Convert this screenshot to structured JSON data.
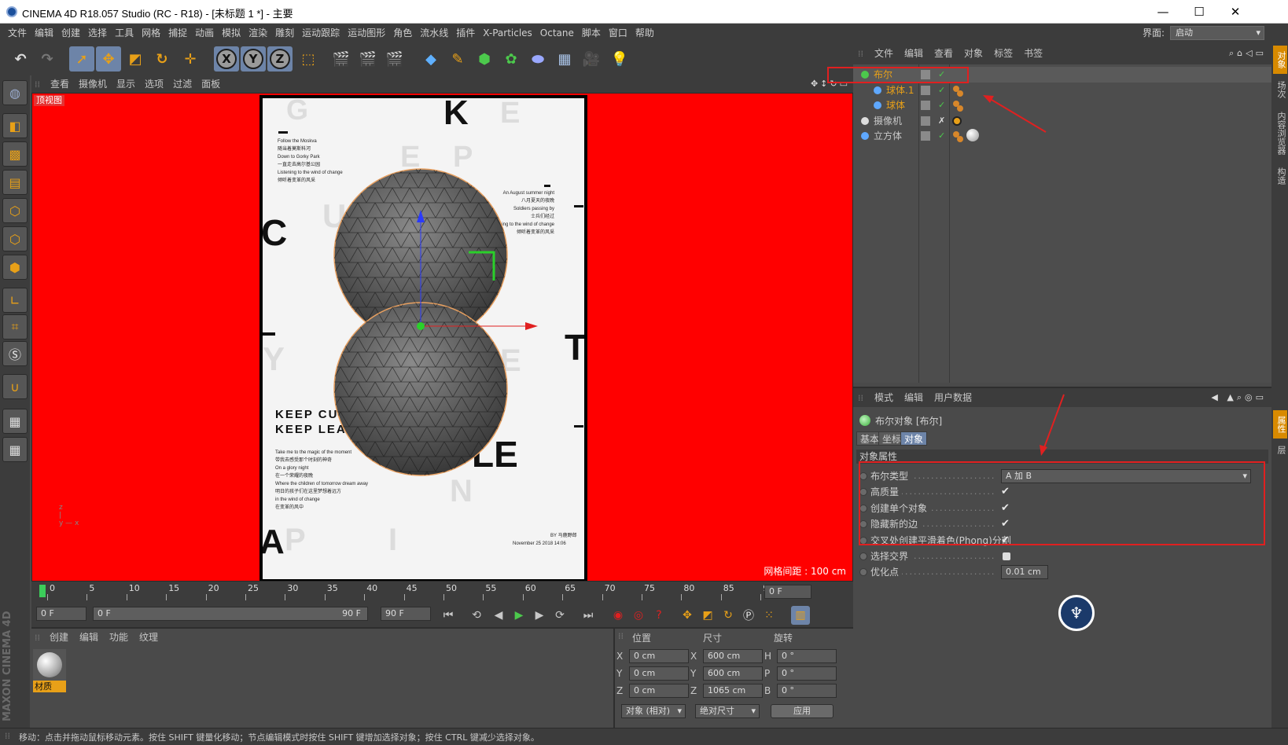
{
  "window": {
    "title": "CINEMA 4D R18.057 Studio (RC - R18) - [未标题 1 *] - 主要",
    "minimize": "—",
    "maximize": "☐",
    "close": "✕"
  },
  "menu": {
    "items": [
      "文件",
      "编辑",
      "创建",
      "选择",
      "工具",
      "网格",
      "捕捉",
      "动画",
      "模拟",
      "渲染",
      "雕刻",
      "运动跟踪",
      "运动图形",
      "角色",
      "流水线",
      "插件",
      "X-Particles",
      "Octane",
      "脚本",
      "窗口",
      "帮助"
    ],
    "layout_label": "界面:",
    "layout_value": "启动"
  },
  "toolbar": {
    "undo": "↶",
    "redo": "↷",
    "axis_x": "X",
    "axis_y": "Y",
    "axis_z": "Z"
  },
  "viewport": {
    "menu": [
      "查看",
      "摄像机",
      "显示",
      "选项",
      "过滤",
      "面板"
    ],
    "label": "顶视图",
    "grid_distance": "网格间距 : 100 cm"
  },
  "poster": {
    "big_letters": [
      "K",
      "C",
      "T",
      "LE"
    ],
    "ghost_letters": [
      "G",
      "E",
      "E",
      "P",
      "U",
      "Y",
      "E",
      "N",
      "I",
      "A",
      "P"
    ],
    "block_left_top": [
      "Follow the Moskva",
      "随当着莫斯科河",
      "Down to Gorky Park",
      "一直走去高尔基公园",
      "Listening to the wind of change",
      "倾听着变革的风采"
    ],
    "block_right": [
      "An August summer night",
      "八月夏天的夜晚",
      "Soldiers passing by",
      "士兵们经过",
      "Listening to the wind of change",
      "倾听着变革的风采"
    ],
    "heading1": "KEEP CUR",
    "heading2": "KEEP LEAR",
    "block_left_bottom": [
      "Take me to the magic of the moment",
      "带我去感受那个时刻的神奇",
      "On a glory night",
      "在一个荣耀的夜晚",
      "Where the children of tomorrow dream away",
      "明日的孩子们在这里梦想着远方",
      "in the wind of change",
      "在变革的风中"
    ],
    "by_line": "BY 马鹿野郎",
    "date_line": "November 25 2018 14:06"
  },
  "object_manager": {
    "menu": [
      "文件",
      "编辑",
      "查看",
      "对象",
      "标签",
      "书签"
    ],
    "objects": [
      {
        "name": "布尔",
        "color": "#e8a018"
      },
      {
        "name": "球体.1",
        "color": "#e8a018"
      },
      {
        "name": "球体",
        "color": "#e8a018"
      },
      {
        "name": "摄像机",
        "color": "#c8c8c8"
      },
      {
        "name": "立方体",
        "color": "#c8c8c8"
      }
    ],
    "check": "✓",
    "cross": "✗"
  },
  "attribute_manager": {
    "menu": [
      "模式",
      "编辑",
      "用户数据"
    ],
    "object_title": "布尔对象 [布尔]",
    "tabs": [
      "基本",
      "坐标",
      "对象"
    ],
    "active_tab": "对象",
    "section": "对象属性",
    "properties": [
      {
        "label": "布尔类型",
        "value": "A 加 B"
      },
      {
        "label": "高质量",
        "value": "✔"
      },
      {
        "label": "创建单个对象",
        "value": "✔"
      },
      {
        "label": "隐藏新的边",
        "value": "✔"
      },
      {
        "label": "交叉处创建平滑着色(Phong)分割",
        "value": "✔"
      },
      {
        "label": "选择交界",
        "value": ""
      },
      {
        "label": "优化点",
        "value": "0.01 cm"
      }
    ]
  },
  "right_tabs": [
    "对象",
    "场次",
    "内容浏览器",
    "构造",
    "属性",
    "层"
  ],
  "timeline": {
    "ticks": [
      "0",
      "5",
      "10",
      "15",
      "20",
      "25",
      "30",
      "35",
      "40",
      "45",
      "50",
      "55",
      "60",
      "65",
      "70",
      "75",
      "80",
      "85",
      "90"
    ],
    "current_frame": "0 F",
    "start": "0 F",
    "range_start": "0 F",
    "range_end": "90 F",
    "end": "90 F"
  },
  "materials": {
    "menu": [
      "创建",
      "编辑",
      "功能",
      "纹理"
    ],
    "item_name": "材质"
  },
  "coordinates": {
    "headers": [
      "位置",
      "尺寸",
      "旋转"
    ],
    "rows": [
      {
        "axis": "X",
        "pos": "0 cm",
        "size_axis": "X",
        "size": "600 cm",
        "rot_axis": "H",
        "rot": "0 °"
      },
      {
        "axis": "Y",
        "pos": "0 cm",
        "size_axis": "Y",
        "size": "600 cm",
        "rot_axis": "P",
        "rot": "0 °"
      },
      {
        "axis": "Z",
        "pos": "0 cm",
        "size_axis": "Z",
        "size": "1065 cm",
        "rot_axis": "B",
        "rot": "0 °"
      }
    ],
    "mode": "对象 (相对)",
    "size_mode": "绝对尺寸",
    "apply": "应用"
  },
  "status": {
    "text": "移动：点击并拖动鼠标移动元素。按住 SHIFT 键量化移动；节点编辑模式时按住 SHIFT 键增加选择对象；按住 CTRL 键减少选择对象。"
  },
  "brand": "MAXON CINEMA 4D",
  "colors": {
    "accent": "#e8a018",
    "selected": "#6d84a8",
    "annotation": "#e02020",
    "viewport_bg": "#ff0000"
  }
}
